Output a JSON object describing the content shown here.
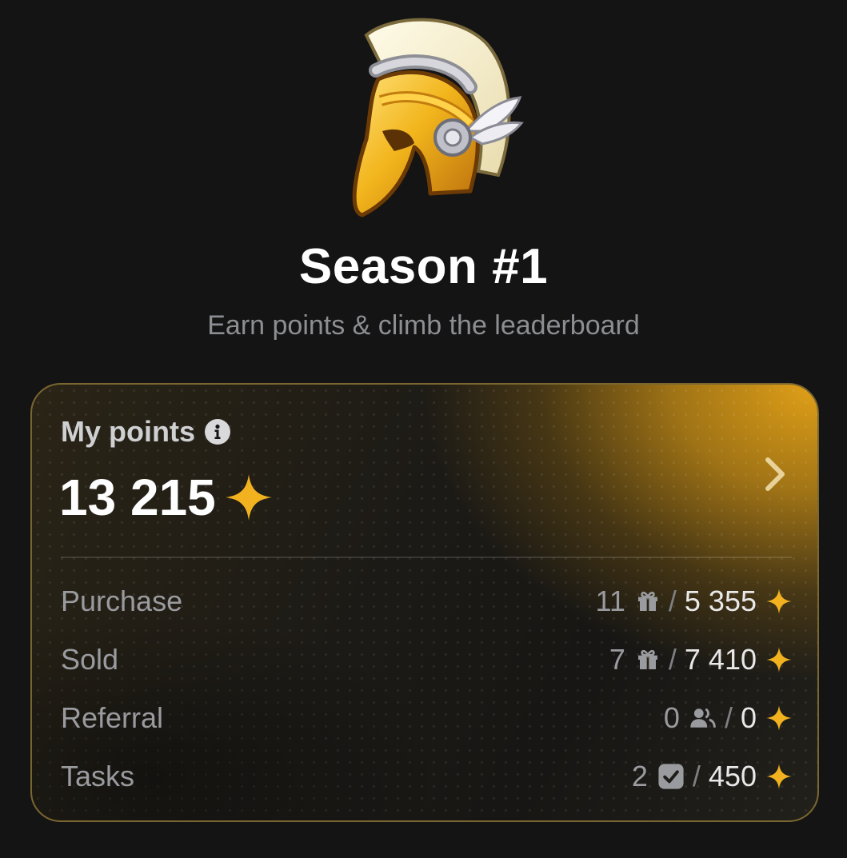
{
  "header": {
    "title": "Season #1",
    "subtitle": "Earn points & climb the leaderboard",
    "icon": "spartan-helmet-icon"
  },
  "points_card": {
    "label": "My points",
    "total": "13 215",
    "accent_color": "#f2b21f",
    "rows": [
      {
        "label": "Purchase",
        "count": "11",
        "icon": "gift-icon",
        "points": "5 355"
      },
      {
        "label": "Sold",
        "count": "7",
        "icon": "gift-icon",
        "points": "7 410"
      },
      {
        "label": "Referral",
        "count": "0",
        "icon": "users-icon",
        "points": "0"
      },
      {
        "label": "Tasks",
        "count": "2",
        "icon": "checkbox-icon",
        "points": "450"
      }
    ]
  }
}
